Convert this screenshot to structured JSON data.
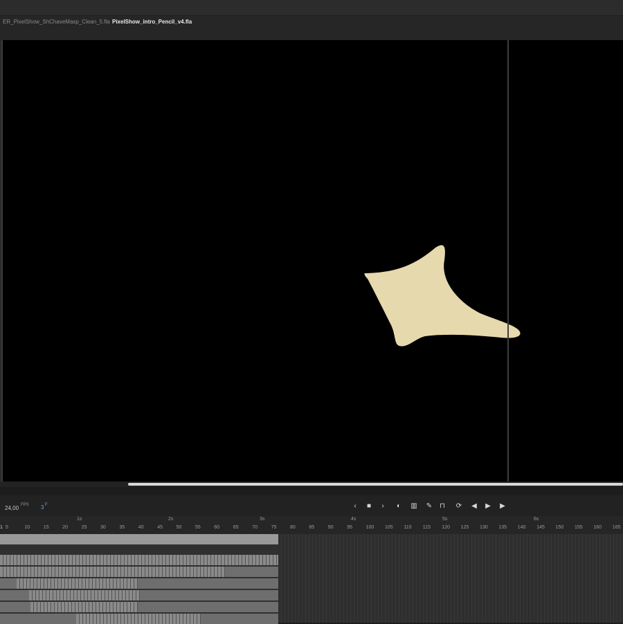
{
  "tabs": [
    {
      "label": "ER_PixelShow_ShChaveMasp_Clean_5.fla",
      "close": "×",
      "active": false
    },
    {
      "label": "PixelShow_intro_Pencil_v4.fla",
      "active": true
    }
  ],
  "colors": {
    "stage": "#000000",
    "shape": "#e6d9ad",
    "accent": "#4da3ff"
  },
  "timeline": {
    "fps_value": "24,00",
    "fps_label": "FPS",
    "current_frame": "3",
    "frame_label": "F",
    "seconds": [
      "1s",
      "2s",
      "3s",
      "4s",
      "5s",
      "6s"
    ],
    "frame_ticks": [
      "5",
      "10",
      "15",
      "20",
      "25",
      "30",
      "35",
      "40",
      "45",
      "50",
      "55",
      "60",
      "65",
      "70",
      "75",
      "80",
      "85",
      "90",
      "95",
      "100",
      "105",
      "110",
      "115",
      "120",
      "125",
      "130",
      "135",
      "140",
      "145",
      "150",
      "155",
      "160",
      "165"
    ],
    "playhead_label": "1",
    "controls": [
      {
        "name": "prev-frame",
        "icon": "chevron-left-icon",
        "glyph": "‹"
      },
      {
        "name": "stop",
        "icon": "stop-icon",
        "glyph": "■"
      },
      {
        "name": "next-frame",
        "icon": "chevron-right-icon",
        "glyph": "›"
      },
      {
        "name": "onion-skin",
        "icon": "onion-skin-icon",
        "glyph": "◐"
      },
      {
        "name": "edit-multiple-frames",
        "icon": "frames-icon",
        "glyph": "▥"
      },
      {
        "name": "camera",
        "icon": "camera-icon",
        "glyph": "✎"
      },
      {
        "name": "center-frame",
        "icon": "center-frame-icon",
        "glyph": "⊓"
      },
      {
        "name": "loop",
        "icon": "loop-icon",
        "glyph": "⟳"
      },
      {
        "name": "step-back",
        "icon": "step-back-icon",
        "glyph": "◀"
      },
      {
        "name": "play",
        "icon": "play-icon",
        "glyph": "▶"
      },
      {
        "name": "step-forward",
        "icon": "step-forward-icon",
        "glyph": "▶"
      }
    ]
  }
}
